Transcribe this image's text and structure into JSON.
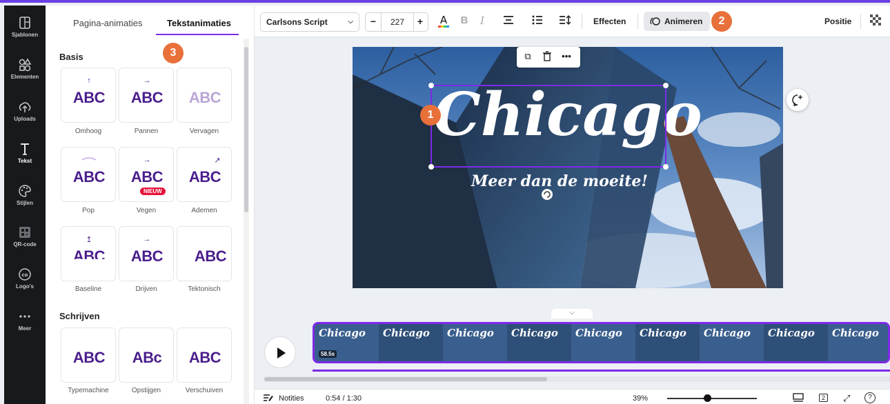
{
  "sidebar": {
    "items": [
      {
        "label": "Sjablonen",
        "icon": "templates-icon"
      },
      {
        "label": "Elementen",
        "icon": "elements-icon"
      },
      {
        "label": "Uploads",
        "icon": "upload-icon"
      },
      {
        "label": "Tekst",
        "icon": "text-icon"
      },
      {
        "label": "Stijlen",
        "icon": "palette-icon"
      },
      {
        "label": "QR-code",
        "icon": "qr-code-icon"
      },
      {
        "label": "Logo's",
        "icon": "logo-icon"
      },
      {
        "label": "Meer",
        "icon": "more-icon"
      }
    ]
  },
  "panel": {
    "tabs": [
      "Pagina-animaties",
      "Tekstanimaties"
    ],
    "sections": {
      "basis": "Basis",
      "schrijven": "Schrijven"
    },
    "basis_items": [
      {
        "label": "Omhoog",
        "preview": "ABC",
        "arrow": "↑"
      },
      {
        "label": "Pannen",
        "preview": "ABC",
        "arrow": "→"
      },
      {
        "label": "Vervagen",
        "preview": "ABC",
        "arrow": ""
      },
      {
        "label": "Pop",
        "preview": "ABC",
        "arrow": ""
      },
      {
        "label": "Vegen",
        "preview": "ABC",
        "arrow": "→",
        "badge": "NIEUW"
      },
      {
        "label": "Ademen",
        "preview": "ABC",
        "arrow": "↗"
      },
      {
        "label": "Baseline",
        "preview": "ABC",
        "arrow": "↥"
      },
      {
        "label": "Drijven",
        "preview": "ABC",
        "arrow": "→"
      },
      {
        "label": "Tektonisch",
        "preview": "ABC",
        "arrow": ""
      }
    ],
    "schrijven_items": [
      {
        "label": "Typemachine",
        "preview": "ABC"
      },
      {
        "label": "Opstijgen",
        "preview": "ABc"
      },
      {
        "label": "Verschuiven",
        "preview": "ABC"
      }
    ]
  },
  "toolbar": {
    "font": "Carlsons Script",
    "font_size": "227",
    "minus": "−",
    "plus": "+",
    "bold": "B",
    "italic": "I",
    "effects": "Effecten",
    "animate": "Animeren",
    "position": "Positie"
  },
  "canvas": {
    "title": "Chicago",
    "subtitle": "Meer dan de moeite!"
  },
  "callouts": {
    "one": "1",
    "two": "2",
    "three": "3"
  },
  "timeline": {
    "duration_badge": "58.5s",
    "frame_text": "Chicago"
  },
  "bottombar": {
    "notes": "Notities",
    "time": "0:54 / 1:30",
    "zoom": "39%",
    "pages": "2"
  },
  "colors": {
    "accent": "#7d2ae8",
    "callout": "#e8703a",
    "preview_text": "#4a1e8c",
    "new_badge": "#e5133a"
  }
}
